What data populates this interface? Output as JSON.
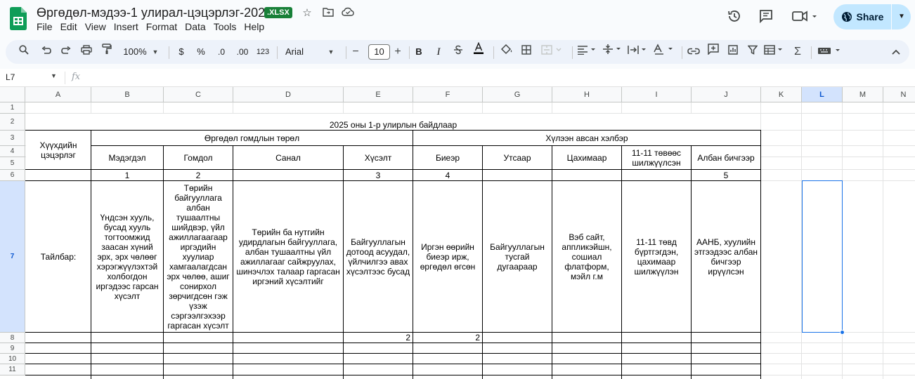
{
  "app": {
    "doc_title": "Өргөдөл-мэдээ-1 улирал-цэцэрлэг-2025",
    "file_badge": ".XLSX",
    "menu": [
      "File",
      "Edit",
      "View",
      "Insert",
      "Format",
      "Data",
      "Tools",
      "Help"
    ],
    "share_label": "Share"
  },
  "toolbar": {
    "zoom": "100%",
    "currency": "$",
    "percent": "%",
    "dec_decrease": ".0",
    "dec_increase": ".00",
    "number_format": "123",
    "font_name": "Arial",
    "font_size": "10",
    "minus": "−",
    "plus": "+",
    "bold": "B",
    "italic": "I"
  },
  "formula_bar": {
    "name_box": "L7",
    "fx": "fx",
    "value": ""
  },
  "sheet": {
    "columns": [
      "A",
      "B",
      "C",
      "D",
      "E",
      "F",
      "G",
      "H",
      "I",
      "J",
      "K",
      "L",
      "M",
      "N"
    ],
    "rows": [
      "1",
      "2",
      "3",
      "4",
      "5",
      "6",
      "7",
      "8",
      "9",
      "10",
      "11"
    ],
    "selected_column": "L",
    "selected_row": "7",
    "selected_cell": "L7",
    "title": "2025 оны 1-р улирлын байдлаар",
    "kindergarten_header": "Хүүхдийн цэцэрлэг",
    "group_type": "Өргөдөл гомдлын төрөл",
    "group_channel": "Хүлээн авсан хэлбэр",
    "headers": {
      "B": "Мэдэгдэл",
      "C": "Гомдол",
      "D": "Санал",
      "E": "Хүсэлт",
      "F": "Биеэр",
      "G": "Утсаар",
      "H": "Цахимаар",
      "I": "11-11 төвөөс шилжүүлсэн",
      "J": "Албан бичгээр"
    },
    "numbers": {
      "B": "1",
      "C": "2",
      "E": "3",
      "F": "4",
      "J": "5"
    },
    "row7_label": "Тайлбар:",
    "descriptions": {
      "B": "Үндсэн хууль, бусад хууль тогтоомжид заасан хүний эрх, эрх чөлөөг хэрэгжүүлэхтэй холбогдон иргэдээс гарсан хүсэлт",
      "C": "Төрийн байгууллага албан тушаалтны шийдвэр, үйл ажиллагаагаар иргэдийн хуулиар хамгаалагдсан эрх чөлөө, ашиг сонирхол зөрчигдсөн гэж үзэж сэргээлгэхээр гаргасан хүсэлт",
      "D": "Төрийн ба нутгийн удирдлагын байгууллага, албан тушаалтны үйл ажиллагааг сайжруулах, шинэчлэх талаар гаргасан иргэний хүсэлтийг",
      "E": "Байгууллагын дотоод асуудал, үйлчилгээ авах хүсэлтээс бусад",
      "F": "Иргэн өөрийн биеэр ирж, өргөдөл өгсөн",
      "G": "Байгууллагын тусгай дугаараар",
      "H": "Вэб сайт, аппликэйшн, сошиал флатформ, мэйл г.м",
      "I": "11-11 төвд бүртгэгдэн, цахимаар шилжүүлэн",
      "J": "ААНБ, хуулийн этгээдээс албан бичгээр ирүүлсэн"
    },
    "row8": {
      "E": "2",
      "F": "2"
    }
  }
}
